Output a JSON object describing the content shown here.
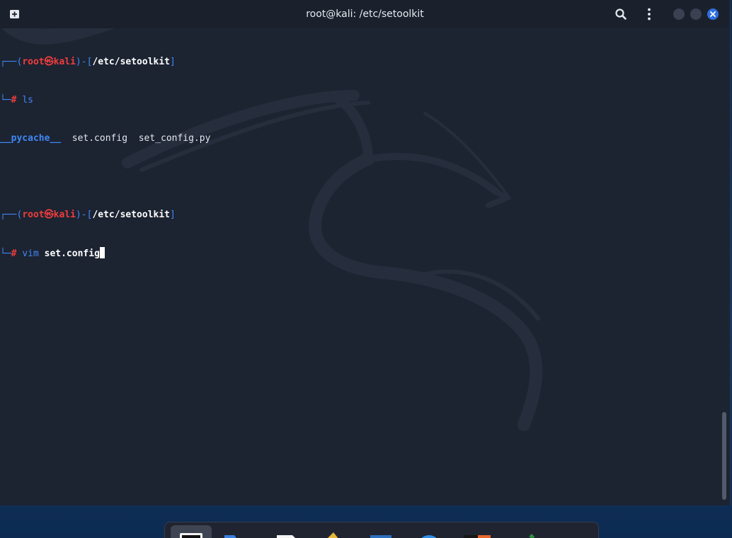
{
  "window": {
    "title": "root@kali: /etc/setoolkit",
    "icons": {
      "new_tab": "new-tab-icon",
      "search": "search-icon",
      "menu": "kebab-menu-icon",
      "minimize": "minimize-icon",
      "maximize": "maximize-icon",
      "close": "close-icon"
    }
  },
  "terminal": {
    "prompt1": {
      "corner": "┌──(",
      "user": "root",
      "at": "㉿",
      "host": "kali",
      "mid": ")-[",
      "path": "/etc/setoolkit",
      "end": "]"
    },
    "cmd1": {
      "corner": "└─",
      "hash": "#",
      "command": "ls"
    },
    "ls_output": {
      "dir": "__pycache__",
      "file1": "set.config",
      "file2": "set_config.py"
    },
    "prompt2": {
      "corner": "┌──(",
      "user": "root",
      "at": "㉿",
      "host": "kali",
      "mid": ")-[",
      "path": "/etc/setoolkit",
      "end": "]"
    },
    "cmd2": {
      "corner": "└─",
      "hash": "#",
      "command": "vim",
      "arg": "set.config"
    }
  },
  "dock": {
    "items": [
      "terminal-icon",
      "files-icon",
      "text-editor-icon",
      "mousepad-icon",
      "maltego-icon",
      "browser-icon",
      "burpsuite-icon",
      "pen-tool-icon",
      "app-grid-icon"
    ]
  },
  "colors": {
    "terminal_bg": "#1c2331",
    "prompt_blue": "#3f88f5",
    "prompt_red": "#ef3d3d",
    "close_blue": "#2f6fe0"
  }
}
